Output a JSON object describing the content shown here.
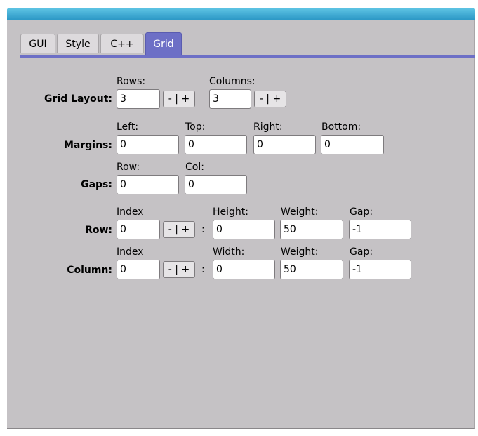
{
  "tabs": [
    "GUI",
    "Style",
    "C++",
    "Grid"
  ],
  "active_tab": "Grid",
  "grid_layout": {
    "label": "Grid Layout:",
    "rows_label": "Rows:",
    "rows_value": "3",
    "columns_label": "Columns:",
    "columns_value": "3",
    "stepper_label": "- | +"
  },
  "margins": {
    "label": "Margins:",
    "left_label": "Left:",
    "left_value": "0",
    "top_label": "Top:",
    "top_value": "0",
    "right_label": "Right:",
    "right_value": "0",
    "bottom_label": "Bottom:",
    "bottom_value": "0"
  },
  "gaps": {
    "label": "Gaps:",
    "row_label": "Row:",
    "row_value": "0",
    "col_label": "Col:",
    "col_value": "0"
  },
  "row": {
    "label": "Row:",
    "index_label": "Index",
    "index_value": "0",
    "stepper_label": "- | +",
    "separator": ":",
    "height_label": "Height:",
    "height_value": "0",
    "weight_label": "Weight:",
    "weight_value": "50",
    "gap_label": "Gap:",
    "gap_value": "-1"
  },
  "column": {
    "label": "Column:",
    "index_label": "Index",
    "index_value": "0",
    "stepper_label": "- | +",
    "separator": ":",
    "width_label": "Width:",
    "width_value": "0",
    "weight_label": "Weight:",
    "weight_value": "50",
    "gap_label": "Gap:",
    "gap_value": "-1"
  }
}
